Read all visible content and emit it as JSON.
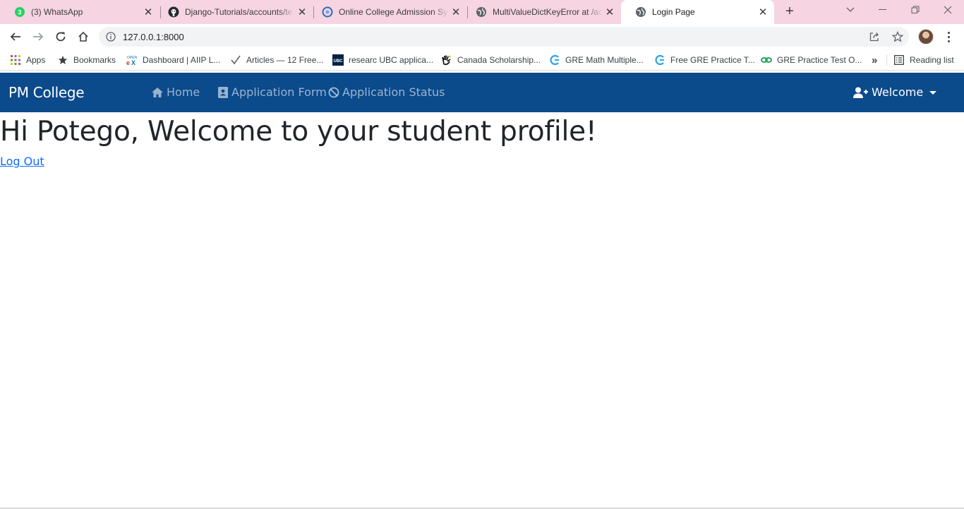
{
  "browser": {
    "tabs": [
      {
        "title": "(3) WhatsApp",
        "icon": "whatsapp-icon",
        "badge": "3"
      },
      {
        "title": "Django-Tutorials/accounts/te",
        "icon": "github-icon"
      },
      {
        "title": "Online College Admission Sy",
        "icon": "site-icon"
      },
      {
        "title": "MultiValueDictKeyError at /ac",
        "icon": "globe-icon"
      },
      {
        "title": "Login Page",
        "icon": "globe-icon",
        "active": true
      }
    ],
    "url": "127.0.0.1:8000",
    "bookmarks": [
      {
        "label": "Apps",
        "icon": "apps-grid-icon"
      },
      {
        "label": "Bookmarks",
        "icon": "star-icon"
      },
      {
        "label": "Dashboard | AIIP L...",
        "icon": "openedx-icon"
      },
      {
        "label": "Articles — 12 Free...",
        "icon": "checkmark-icon"
      },
      {
        "label": "researc UBC applica...",
        "icon": "ubc-icon"
      },
      {
        "label": "Canada Scholarship...",
        "icon": "hand-icon"
      },
      {
        "label": "GRE Math Multiple...",
        "icon": "gre-icon"
      },
      {
        "label": "Free GRE Practice T...",
        "icon": "gre-icon"
      },
      {
        "label": "GRE Practice Test O...",
        "icon": "green-link-icon"
      }
    ],
    "overflow_label": "»",
    "reading_list": "Reading list",
    "colors": {
      "tabstrip": "#f6d4e1",
      "toolbar": "#ffffff"
    }
  },
  "page": {
    "brand": "PM College",
    "nav": [
      {
        "label": "Home",
        "icon": "home-icon"
      },
      {
        "label": "Application Form",
        "icon": "id-card-icon"
      },
      {
        "label": "Application Status",
        "icon": "ban-icon"
      }
    ],
    "welcome": "Welcome",
    "heading": "Hi Potego, Welcome to your student profile!",
    "logout": "Log Out",
    "colors": {
      "navbar": "#0b4a8b",
      "link": "#0d6efd"
    }
  }
}
